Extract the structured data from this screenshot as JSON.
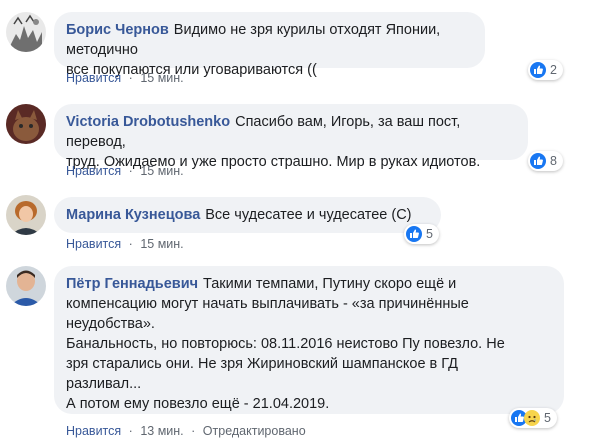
{
  "comments": [
    {
      "author": "Борис Чернов",
      "text": "Видимо не зря курилы отходят Японии, методично\nвсе покупаются или уговариваются ((",
      "like_label": "Нравится",
      "time": "15 мин.",
      "reactions": [
        "like-icon"
      ],
      "reaction_count": "2"
    },
    {
      "author": "Victoria Drobotushenko",
      "text": "Спасибо вам, Игорь, за ваш пост, перевод,\nтруд. Ожидаемо и уже просто страшно. Мир в руках идиотов.",
      "like_label": "Нравится",
      "time": "15 мин.",
      "reactions": [
        "like-icon"
      ],
      "reaction_count": "8"
    },
    {
      "author": "Марина Кузнецова",
      "text": "Все чудесатее и чудесатее (С)",
      "like_label": "Нравится",
      "time": "15 мин.",
      "reactions": [
        "like-icon"
      ],
      "reaction_count": "5"
    },
    {
      "author": "Пётр Геннадьевич",
      "text": "Такими темпами, Путину скоро ещё и\nкомпенсацию могут начать выплачивать - «за причинённые\nнеудобства».\nБанальность, но повторюсь: 08.11.2016 неистово Пу повезло. Не\nзря старались они. Не зря Жириновский шампанское в ГД\nразливал...\nА потом ему повезло ещё - 21.04.2019.",
      "like_label": "Нравится",
      "time": "13 мин.",
      "edited": "Отредактировано",
      "reactions": [
        "like-icon",
        "sad-icon"
      ],
      "reaction_count": "5"
    }
  ],
  "colors": {
    "author": "#385898",
    "bubble": "#f0f2f5",
    "meta": "#606770",
    "like_reaction": "#1877f2"
  }
}
